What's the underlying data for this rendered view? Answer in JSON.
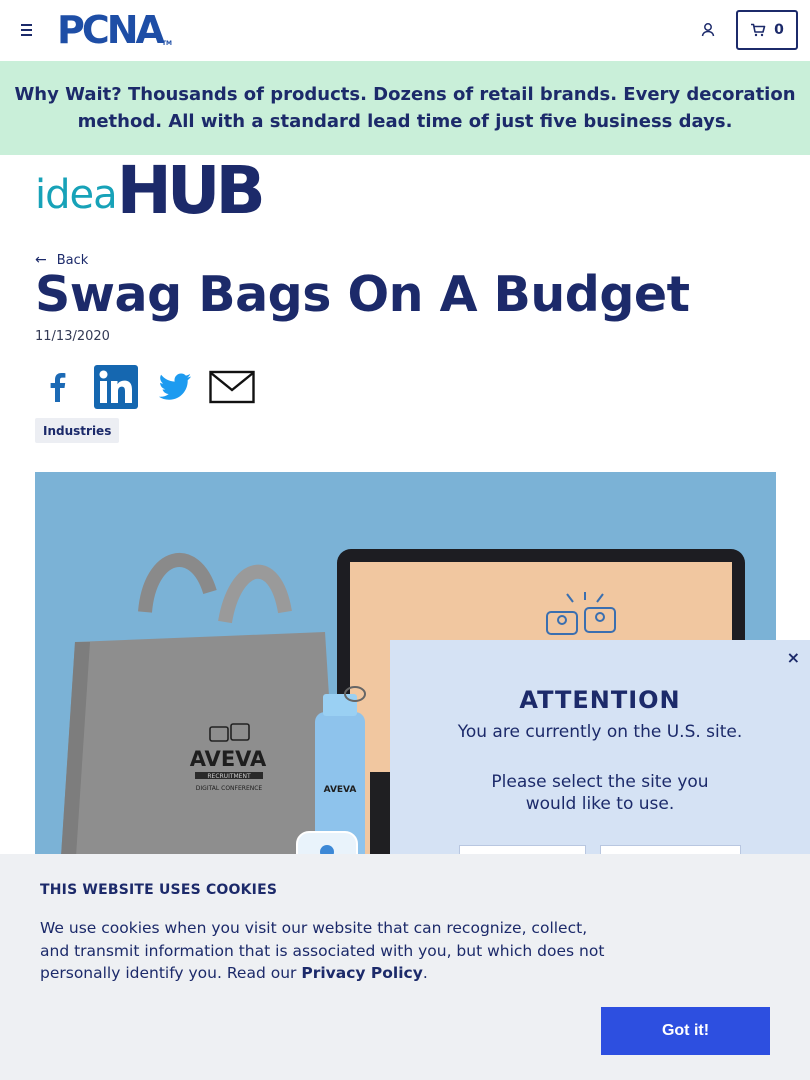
{
  "header": {
    "logo_text": "PCNA",
    "logo_tm": "TM",
    "cart_count": "0"
  },
  "promo": {
    "lead": "Why Wait?",
    "text": "Thousands of products. Dozens of retail brands. Every decoration method. All with a standard lead time of just five business days."
  },
  "ideahub": {
    "idea": "idea",
    "hub": "HUB"
  },
  "article": {
    "back_label": "Back",
    "title": "Swag Bags On A Budget",
    "date": "11/13/2020",
    "tag": "Industries",
    "share_icons": [
      "facebook-icon",
      "linkedin-icon",
      "twitter-icon",
      "email-icon"
    ]
  },
  "hero": {
    "bag_brand": "AVEVA",
    "bag_sub1": "RECRUITMENT",
    "bag_sub2": "DIGITAL CONFERENCE"
  },
  "attention": {
    "close": "×",
    "title": "ATTENTION",
    "line1": "You are currently on the U.S. site.",
    "line2": "Please select the site you would like to use."
  },
  "cookie": {
    "title": "THIS WEBSITE USES COOKIES",
    "text": "We use cookies when you visit our website that can recognize, collect, and transmit information that is associated with you, but which does not personally identify you. Read our ",
    "link": "Privacy Policy",
    "end": ".",
    "button": "Got it!"
  },
  "colors": {
    "navy": "#1c2a6a",
    "promo_bg": "#c9efd9",
    "accent_button": "#2d4fe0",
    "idea_teal": "#17a2b8",
    "hero_bg": "#7bb2d6"
  }
}
